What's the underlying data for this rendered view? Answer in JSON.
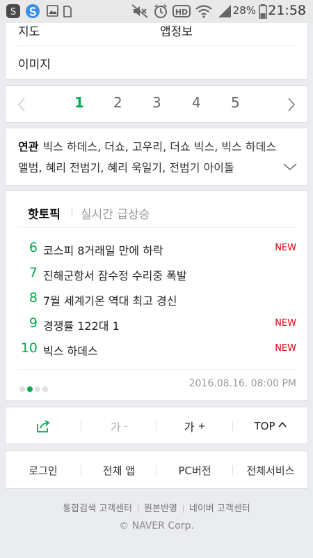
{
  "status_bar": {
    "battery": "28%",
    "time": "21:58",
    "icons": [
      "app-s-icon",
      "app-swirl-icon",
      "gallery-icon",
      "sim-icon",
      "mute-icon",
      "alarm-icon",
      "hd-icon",
      "wifi-icon",
      "signal-icon",
      "battery-icon"
    ]
  },
  "result_tabs": {
    "map": "지도",
    "app_info": "앱정보",
    "image": "이미지"
  },
  "pagination": {
    "pages": [
      "1",
      "2",
      "3",
      "4",
      "5"
    ],
    "current": "1"
  },
  "related": {
    "label": "연관",
    "terms": "빅스 하데스, 더쇼, 고우리, 더쇼 빅스, 빅스 하데스 앨범, 혜리 전범기, 혜리 욱일기, 전범기 아이돌"
  },
  "hot_topics": {
    "tab_active": "핫토픽",
    "tab_inactive": "실시간 급상승",
    "items": [
      {
        "rank": "6",
        "title": "코스피 8거래일 만에 하락",
        "badge": "NEW"
      },
      {
        "rank": "7",
        "title": "진해군항서 잠수정 수리중 폭발",
        "badge": ""
      },
      {
        "rank": "8",
        "title": "7월 세계기온 역대 최고 경신",
        "badge": ""
      },
      {
        "rank": "9",
        "title": "경쟁률 122대 1",
        "badge": "NEW"
      },
      {
        "rank": "10",
        "title": "빅스 하데스",
        "badge": "NEW"
      }
    ],
    "page_count": 4,
    "active_page": 2,
    "timestamp": "2016.08.16. 08:00 PM"
  },
  "tools": {
    "font_down": "가",
    "font_down_sign": "-",
    "font_up": "가",
    "font_up_sign": "+",
    "top": "TOP"
  },
  "bottom_nav": [
    "로그인",
    "전체 앱",
    "PC버전",
    "전체서비스"
  ],
  "footer": {
    "links": [
      "통합검색 고객센터",
      "원본반영",
      "네이버 고객센터"
    ],
    "copyright": "© NAVER Corp."
  },
  "colors": {
    "accent_green": "#03a94d",
    "new_red": "#e2000f",
    "page_bg": "#ebecef"
  }
}
